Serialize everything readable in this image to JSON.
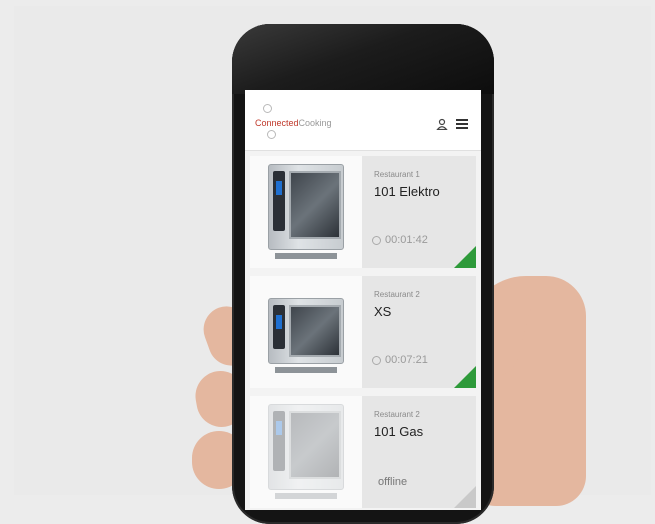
{
  "app": {
    "logo_text": "Connected",
    "logo_sub": "Cooking",
    "user_icon": "user-icon",
    "menu_icon": "menu-icon"
  },
  "colors": {
    "brand": "#c0392b",
    "status_online": "#2e9a3a",
    "status_offline": "#c9c9c9"
  },
  "units": [
    {
      "location": "Restaurant 1",
      "name": "101 Elektro",
      "timer": "00:01:42",
      "status": "online"
    },
    {
      "location": "Restaurant 2",
      "name": "XS",
      "timer": "00:07:21",
      "status": "online"
    },
    {
      "location": "Restaurant 2",
      "name": "101 Gas",
      "timer": "offline",
      "status": "offline"
    }
  ]
}
